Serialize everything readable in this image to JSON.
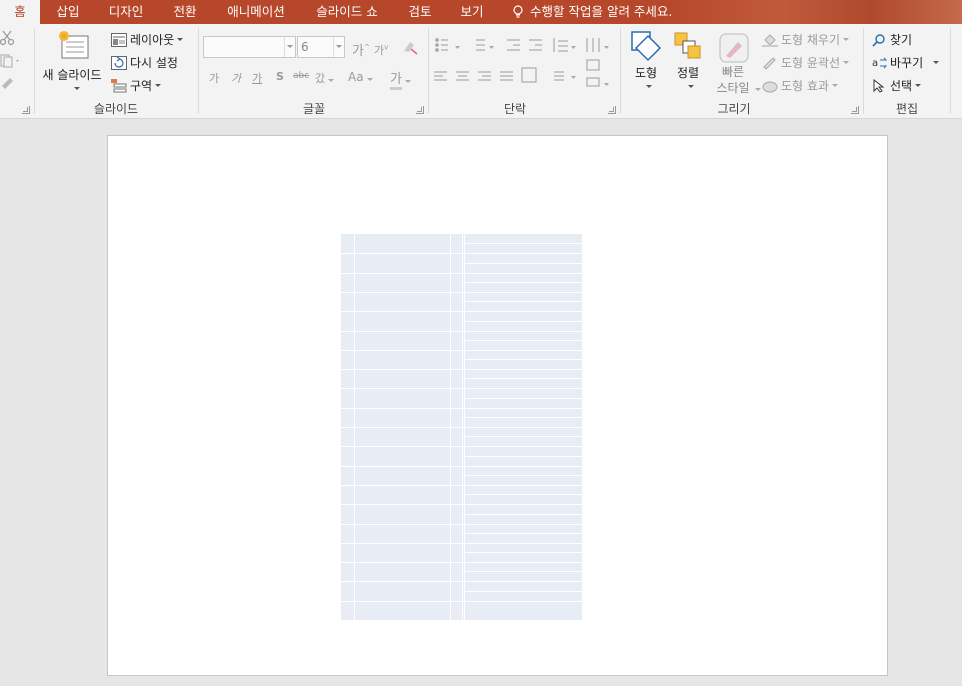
{
  "tabs": [
    {
      "label": "홈",
      "active": true
    },
    {
      "label": "삽입"
    },
    {
      "label": "디자인"
    },
    {
      "label": "전환"
    },
    {
      "label": "애니메이션"
    },
    {
      "label": "슬라이드 쇼"
    },
    {
      "label": "검토"
    },
    {
      "label": "보기"
    }
  ],
  "tell_me": "수행할 작업을 알려 주세요.",
  "colors": {
    "accent": "#b7472a",
    "ribbon_bg": "#f3f3f3",
    "workspace_bg": "#e6e6e6",
    "table_fill": "#e8edf5"
  },
  "groups": {
    "slides": {
      "label": "슬라이드",
      "new_slide": "새 슬라이드",
      "layout": "레이아웃",
      "reset": "다시 설정",
      "section": "구역"
    },
    "font": {
      "label": "글꼴",
      "font_name": "",
      "font_size": "6",
      "bold": "가",
      "italic": "가",
      "underline": "가",
      "shadow": "S",
      "strike": "abc",
      "spacing": "갔",
      "case": "Aa",
      "color": "가"
    },
    "paragraph": {
      "label": "단락"
    },
    "drawing": {
      "label": "그리기",
      "shapes": "도형",
      "arrange": "정렬",
      "quick_styles_1": "빠른",
      "quick_styles_2": "스타일",
      "shape_fill": "도형 채우기",
      "shape_outline": "도형 윤곽선",
      "shape_effects": "도형 효과"
    },
    "editing": {
      "label": "편집",
      "find": "찾기",
      "replace": "바꾸기",
      "select": "선택"
    }
  },
  "slide_table": {
    "rows": 20,
    "cols": 4
  }
}
